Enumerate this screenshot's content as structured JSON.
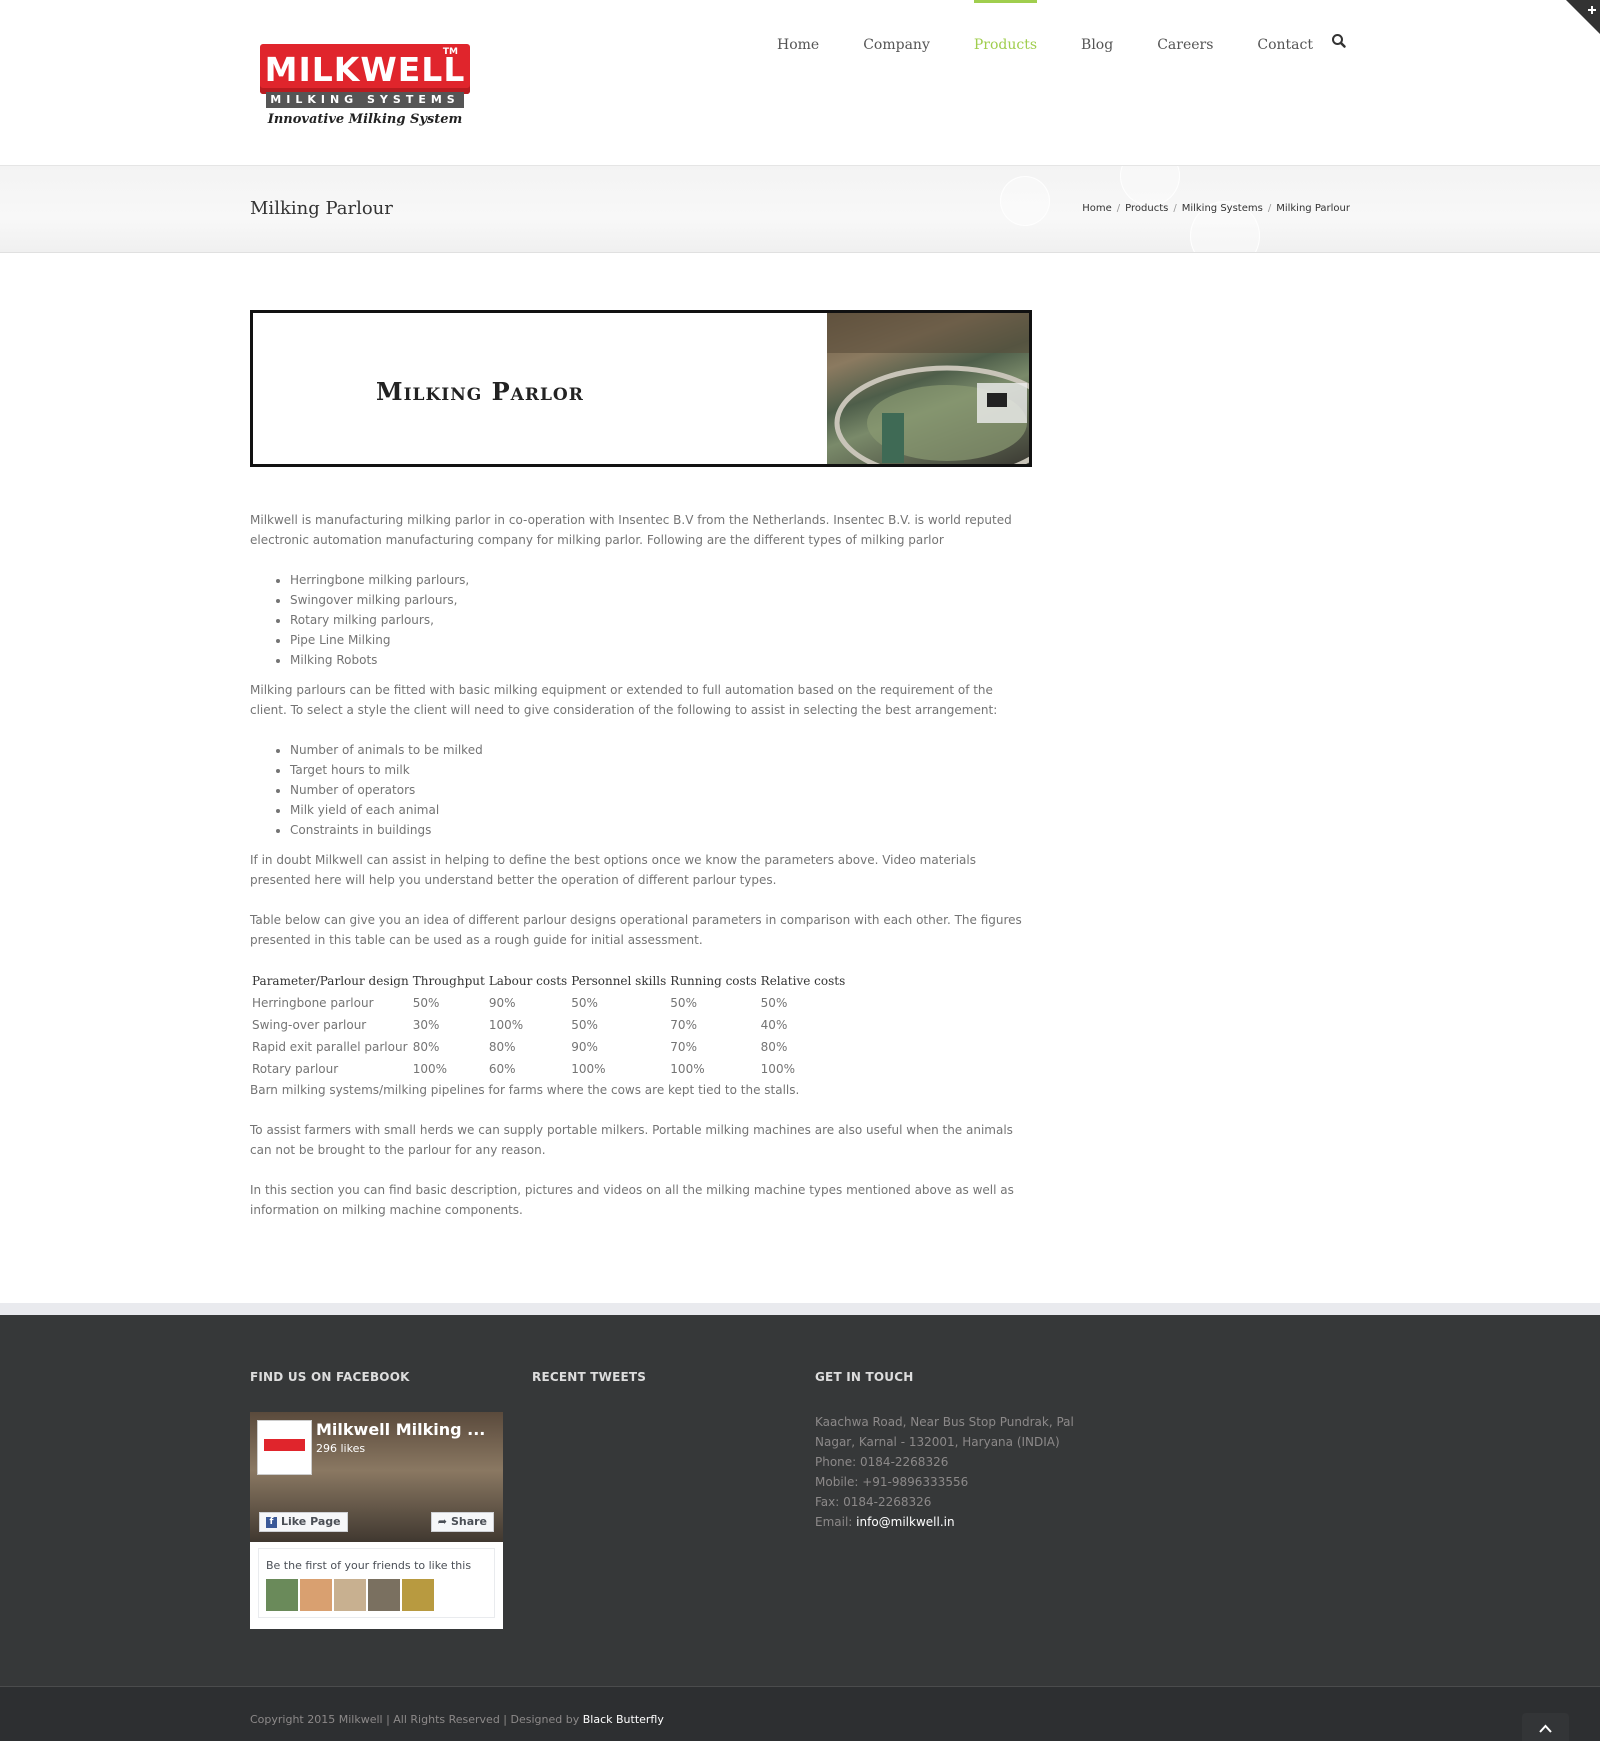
{
  "brand": {
    "logo_word": "MILKWELL",
    "logo_tm": "TM",
    "logo_sub": "MILKING SYSTEMS",
    "logo_tagline": "Innovative Milking System",
    "red": "#e0252c",
    "accent": "#a0ce4e"
  },
  "nav": {
    "items": [
      {
        "label": "Home"
      },
      {
        "label": "Company"
      },
      {
        "label": "Products"
      },
      {
        "label": "Blog"
      },
      {
        "label": "Careers"
      },
      {
        "label": "Contact"
      }
    ],
    "active": "Products",
    "search_icon": "search-icon"
  },
  "titlebar": {
    "title": "Milking Parlour",
    "breadcrumb": [
      "Home",
      "Products",
      "Milking Systems",
      "Milking Parlour"
    ]
  },
  "main": {
    "banner_text": "Milking Parlor",
    "intro": "Milkwell is manufacturing milking parlor in co-operation with Insentec B.V from the Netherlands. Insentec B.V. is world reputed electronic automation manufacturing company for milking parlor. Following are the different types of milking parlor",
    "parlour_types": [
      "Herringbone milking parlours,",
      "Swingover milking parlours,",
      "Rotary milking parlours,",
      "Pipe Line Milking",
      "Milking Robots"
    ],
    "para2": "Milking parlours can be fitted with basic milking equipment or extended to full automation based on the requirement of the client. To select a style the client will need to give consideration of the following to assist in selecting the best arrangement:",
    "considerations": [
      "Number of animals to be milked",
      "Target hours to milk",
      "Number of operators",
      "Milk yield of each animal",
      "Constraints in buildings"
    ],
    "para3": "If in doubt Milkwell can assist in helping to define the best options once we know the parameters above. Video materials presented here will help you understand better the operation of different parlour types.",
    "para4": "Table below can give you an idea of different parlour designs operational parameters in comparison with each other. The figures presented in this table can be used as a rough guide for initial assessment.",
    "table": {
      "headers": [
        "Parameter/Parlour design",
        "Throughput",
        "Labour costs",
        "Personnel skills",
        "Running costs",
        "Relative costs"
      ],
      "rows": [
        [
          "Herringbone parlour",
          "50%",
          "90%",
          "50%",
          "50%",
          "50%"
        ],
        [
          "Swing-over parlour",
          "30%",
          "100%",
          "50%",
          "70%",
          "40%"
        ],
        [
          "Rapid exit parallel parlour",
          "80%",
          "80%",
          "90%",
          "70%",
          "80%"
        ],
        [
          "Rotary parlour",
          "100%",
          "60%",
          "100%",
          "100%",
          "100%"
        ]
      ]
    },
    "para5": "Barn milking systems/milking pipelines for farms where the cows are kept tied to the stalls.",
    "para6": "To assist farmers with small herds we can supply portable milkers. Portable milking machines are also useful when the animals can not be brought to the parlour for any reason.",
    "para7": "In this section you can find basic description, pictures and videos on all the milking machine types mentioned above as well as information on milking machine components."
  },
  "footer": {
    "facebook_title": "FIND US ON FACEBOOK",
    "tweets_title": "RECENT TWEETS",
    "contact_title": "GET IN TOUCH",
    "fb": {
      "page_name": "Milkwell Milking ...",
      "likes": "296 likes",
      "like_label": "Like Page",
      "share_label": "Share",
      "friends_text": "Be the first of your friends to like this"
    },
    "contact": {
      "address1": "Kaachwa Road, Near Bus Stop Pundrak, Pal",
      "address2": "Nagar, Karnal - 132001, Haryana (INDIA)",
      "phone": "Phone: 0184-2268326",
      "mobile": "Mobile: +91-9896333556",
      "fax": "Fax: 0184-2268326",
      "email_label": "Email: ",
      "email": "info@milkwell.in"
    },
    "copyright": "Copyright 2015 Milkwell | All Rights Reserved | Designed by ",
    "designer": "Black Butterfly"
  }
}
